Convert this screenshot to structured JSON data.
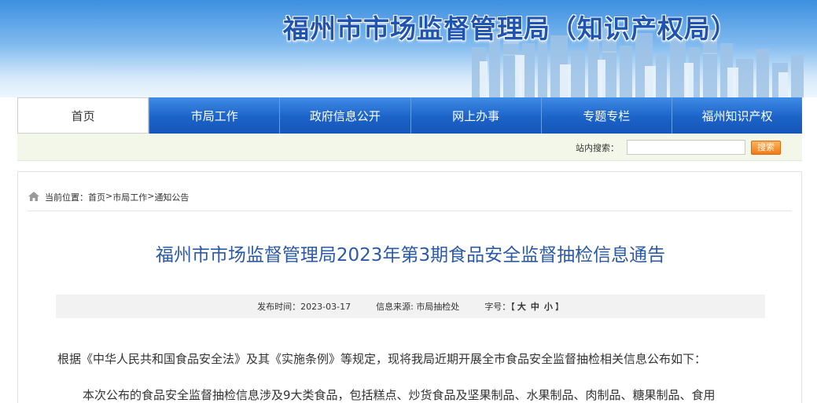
{
  "site": {
    "title": "福州市市场监督管理局（知识产权局）"
  },
  "nav": {
    "items": [
      {
        "label": "首页",
        "active": true
      },
      {
        "label": "市局工作",
        "active": false
      },
      {
        "label": "政府信息公开",
        "active": false
      },
      {
        "label": "网上办事",
        "active": false
      },
      {
        "label": "专题专栏",
        "active": false
      },
      {
        "label": "福州知识产权",
        "active": false
      }
    ]
  },
  "search": {
    "label": "站内搜索：",
    "value": "",
    "placeholder": "",
    "button_label": "搜索"
  },
  "breadcrumb": {
    "icon": "home-icon",
    "prefix": "当前位置：",
    "items": [
      "首页",
      "市局工作",
      "通知公告"
    ],
    "separator": ">"
  },
  "article": {
    "title": "福州市市场监督管理局2023年第3期食品安全监督抽检信息通告",
    "meta": {
      "date_label": "发布时间：",
      "date": "2023-03-17",
      "source_label": "信息来源: ",
      "source": "市局抽检处",
      "size_label": "字号：",
      "size_open": "【",
      "size_large": "大",
      "size_medium": "中",
      "size_small": "小",
      "size_close": "】"
    },
    "paragraphs": [
      "根据《中华人民共和国食品安全法》及其《实施条例》等规定，现将我局近期开展全市食品安全监督抽检相关信息公布如下：",
      "本次公布的食品安全监督抽检信息涉及9大类食品，包括糕点、炒货食品及坚果制品、水果制品、肉制品、糖果制品、食用"
    ]
  },
  "colors": {
    "nav_blue": "#1c63c8",
    "title_blue": "#2a5aa8",
    "search_button": "#f07c16",
    "banner_title": "#1f54b0"
  }
}
